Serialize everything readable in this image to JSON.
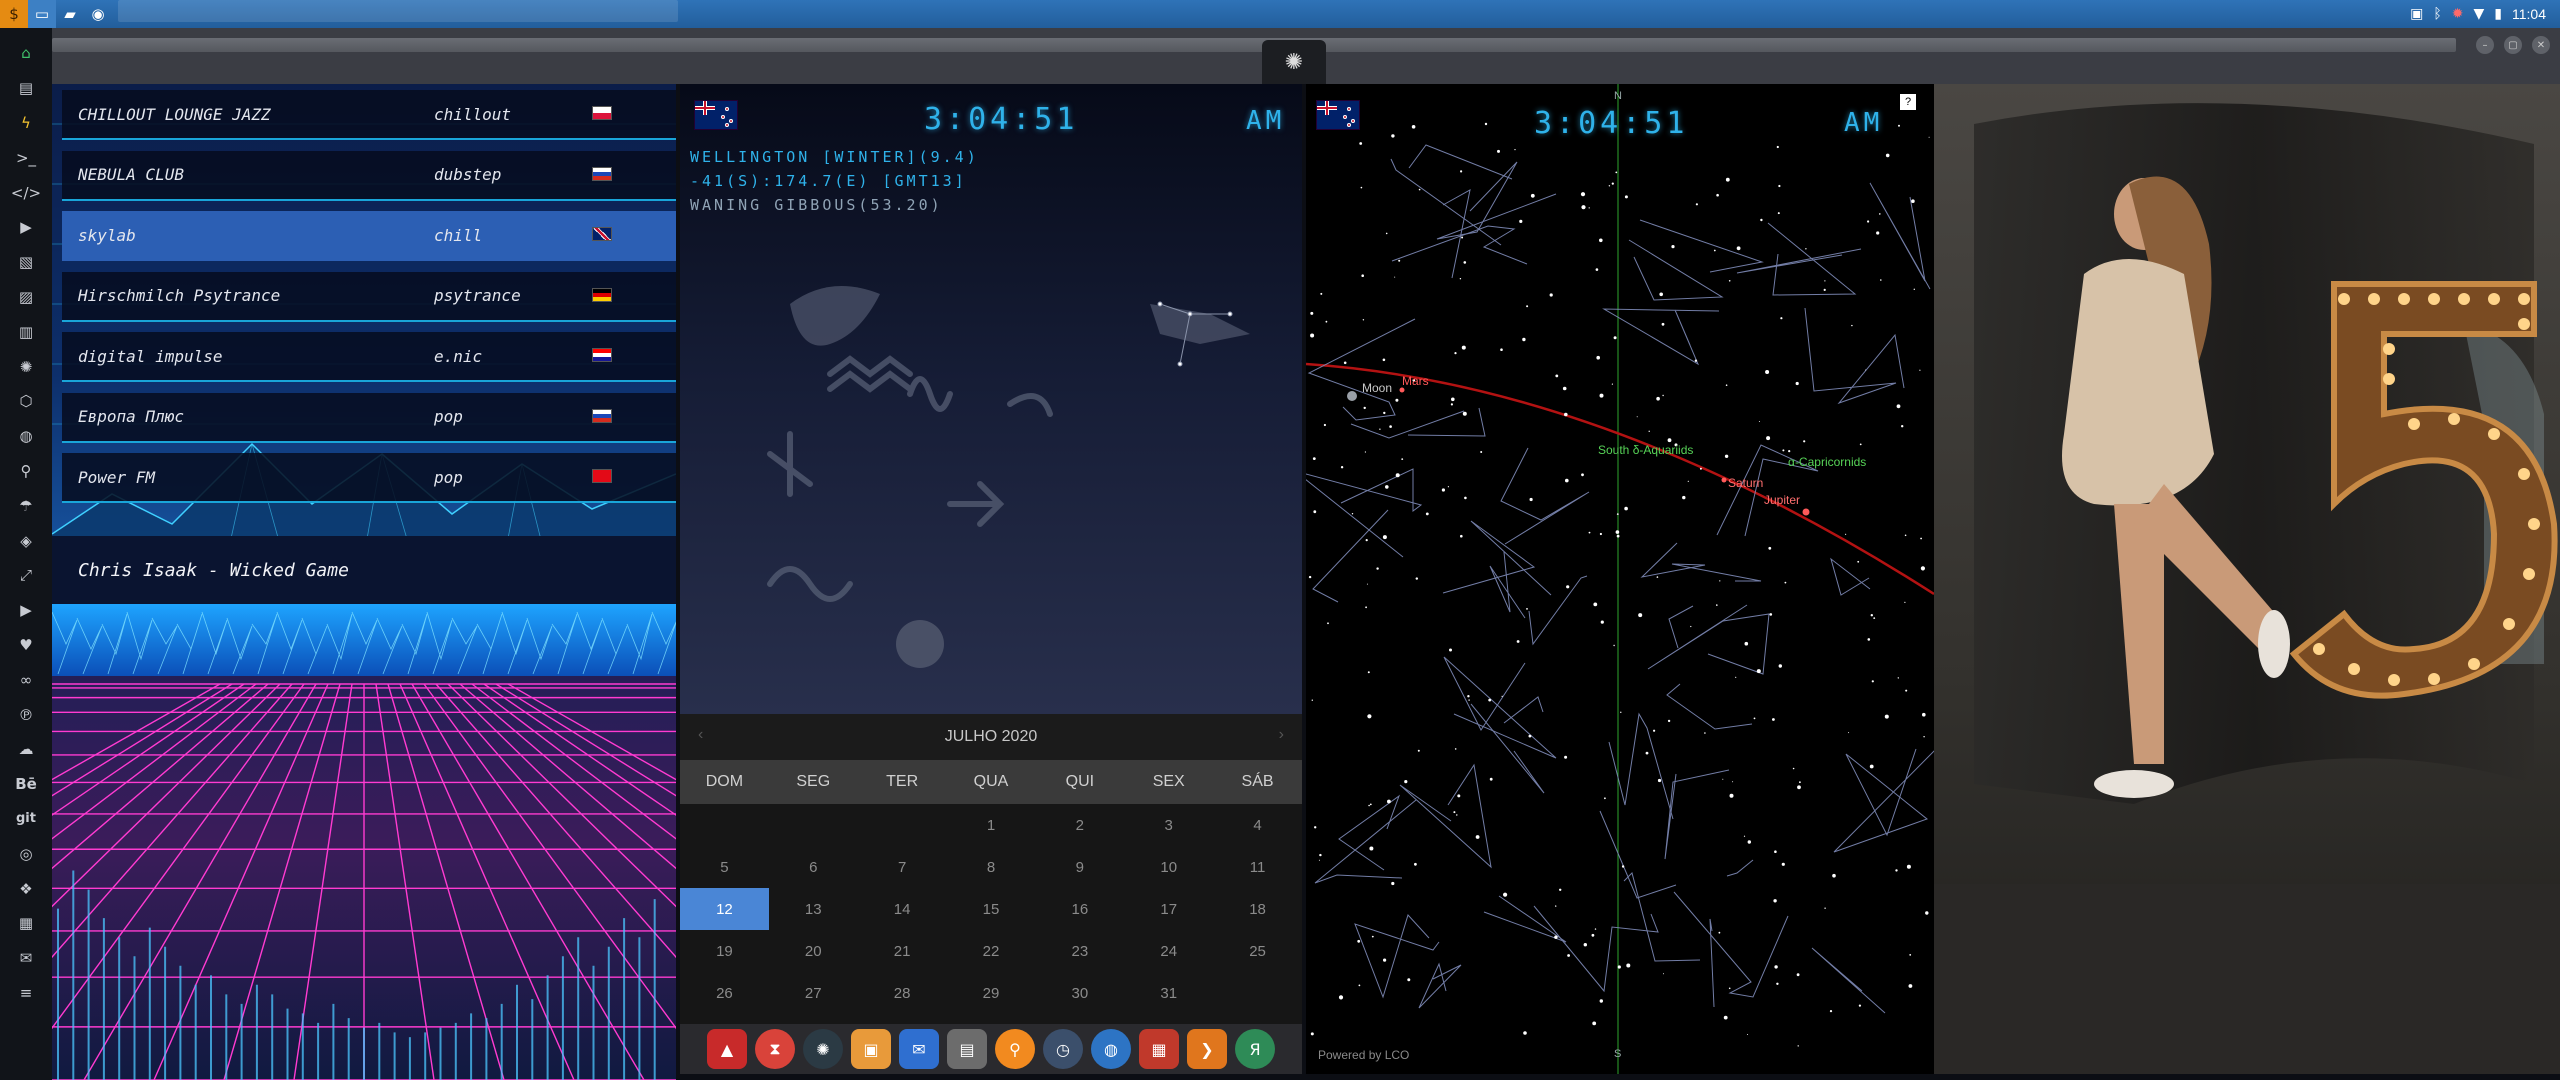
{
  "topbar": {
    "clock": "11:04",
    "left_icons": [
      "app-menu-icon",
      "folder-icon",
      "chrome-icon"
    ],
    "tray_icons": [
      "image-icon",
      "bluetooth-icon",
      "settings-icon",
      "wifi-icon",
      "battery-icon"
    ]
  },
  "sidebar": {
    "icons": [
      "home-icon",
      "document-icon",
      "bolt-icon",
      "terminal-icon",
      "code-icon",
      "play-icon",
      "video-icon",
      "image-icon",
      "id-card-icon",
      "rebel-icon",
      "film-icon",
      "globe-icon",
      "search-icon",
      "umbrella-icon",
      "tag-icon",
      "expand-icon",
      "youtube-icon",
      "heart-icon",
      "link-icon",
      "pinterest-icon",
      "cloud-icon",
      "behance-icon",
      "git-icon",
      "github-icon",
      "cubes-icon",
      "map-icon",
      "mail-icon",
      "menu-icon"
    ],
    "behance_label": "Bē",
    "git_label": "git"
  },
  "radio": {
    "stations": [
      {
        "name": "CHILLOUT LOUNGE JAZZ",
        "genre": "chillout",
        "flag": "poland"
      },
      {
        "name": "NEBULA CLUB",
        "genre": "dubstep",
        "flag": "russia"
      },
      {
        "name": "skylab",
        "genre": "chill",
        "flag": "uk"
      },
      {
        "name": "Hirschmilch Psytrance",
        "genre": "psytrance",
        "flag": "germany"
      },
      {
        "name": "digital impulse",
        "genre": "e.nic",
        "flag": "croatia"
      },
      {
        "name": "Европа Плюс",
        "genre": "pop",
        "flag": "russia"
      },
      {
        "name": "Power FM",
        "genre": "pop",
        "flag": "turkey"
      }
    ],
    "now_playing": "Chris Isaak - Wicked Game",
    "spectrum_levels": [
      0.36,
      0.44,
      0.4,
      0.34,
      0.3,
      0.26,
      0.32,
      0.28,
      0.24,
      0.2,
      0.22,
      0.18,
      0.16,
      0.2,
      0.18,
      0.15,
      0.14,
      0.12,
      0.16,
      0.13,
      0.11,
      0.12,
      0.1,
      0.09,
      0.1,
      0.11,
      0.12,
      0.14,
      0.13,
      0.16,
      0.2,
      0.17,
      0.22,
      0.26,
      0.3,
      0.24,
      0.28,
      0.34,
      0.3,
      0.38
    ]
  },
  "clock_panel": {
    "time": "3:04:51",
    "ampm": "AM",
    "line1": "WELLINGTON [WINTER](9.4)",
    "line2": "-41(S):174.7(E) [GMT13]",
    "line3": "WANING GIBBOUS(53.20)"
  },
  "calendar": {
    "month_label": "JULHO 2020",
    "prev": "‹",
    "next": "›",
    "weekdays": [
      "DOM",
      "SEG",
      "TER",
      "QUA",
      "QUI",
      "SEX",
      "SÁB"
    ],
    "cells": [
      "",
      "",
      "",
      "1",
      "2",
      "3",
      "4",
      "5",
      "6",
      "7",
      "8",
      "9",
      "10",
      "11",
      "12",
      "13",
      "14",
      "15",
      "16",
      "17",
      "18",
      "19",
      "20",
      "21",
      "22",
      "23",
      "24",
      "25",
      "26",
      "27",
      "28",
      "29",
      "30",
      "31",
      ""
    ],
    "today": "12"
  },
  "dock": {
    "apps": [
      "launcher-icon",
      "timer-icon",
      "terminal-icon",
      "photos-icon",
      "mail-icon",
      "notes-icon",
      "search-icon",
      "clock-icon",
      "globe-icon",
      "calendar-icon",
      "sublime-icon",
      "yandex-icon"
    ]
  },
  "skymap": {
    "time": "3:04:51",
    "ampm": "AM",
    "help": "?",
    "north": "N",
    "south": "S",
    "powered_by": "Powered by LCO",
    "labels": {
      "moon": "Moon",
      "mars": "Mars",
      "saturn": "Saturn",
      "jupiter": "Jupiter",
      "aquariids": "South δ-Aquariids",
      "capricornids": "α-Capricornids"
    }
  },
  "colors": {
    "accent_blue": "#2fb2ea",
    "calendar_today": "#4a86d6",
    "ecliptic": "#b31212",
    "meteor_green": "#57d357",
    "planet_red": "#ff5a5a"
  }
}
